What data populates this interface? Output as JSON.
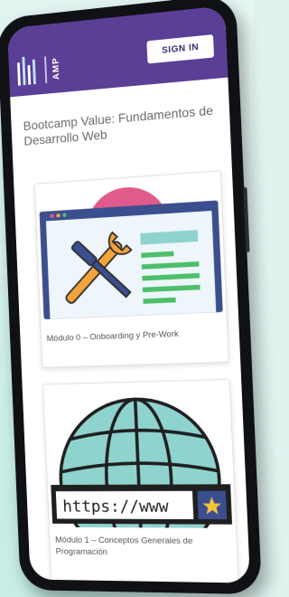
{
  "header": {
    "logo_text": "AMP",
    "signin_label": "SIGN IN"
  },
  "page": {
    "title": "Bootcamp Value: Fundamentos de Desarrollo Web"
  },
  "modules": [
    {
      "label": "Módulo 0 – Onboarding y Pre-Work",
      "icon": "tools-icon"
    },
    {
      "label": "Módulo 1 – Conceptos Generales de Programación",
      "icon": "globe-icon",
      "url_text": "https://www"
    }
  ],
  "colors": {
    "header": "#5b3f96",
    "accent_teal": "#8fd3cf",
    "accent_orange": "#f2a33a",
    "accent_green": "#4cbf6a",
    "accent_pink": "#e05a8c"
  }
}
